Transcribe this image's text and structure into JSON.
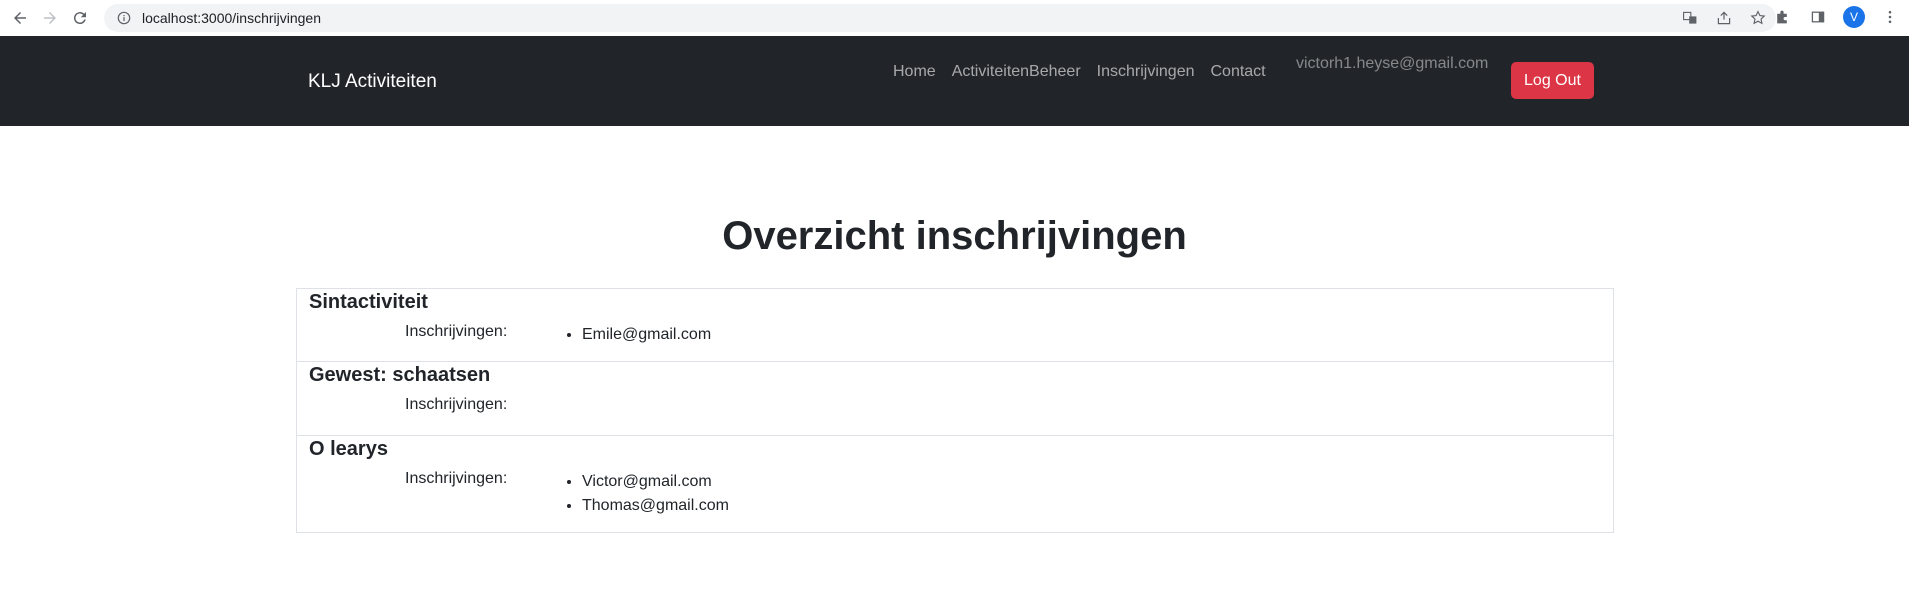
{
  "browser": {
    "url": "localhost:3000/inschrijvingen",
    "avatar_initial": "V"
  },
  "navbar": {
    "brand": "KLJ Activiteiten",
    "links": [
      "Home",
      "ActiviteitenBeheer",
      "Inschrijvingen",
      "Contact"
    ],
    "user_email": "victorh1.heyse@gmail.com",
    "logout_label": "Log Out",
    "background_color": "#212529",
    "logout_color": "#dc3545"
  },
  "main": {
    "title": "Overzicht inschrijvingen",
    "registrations_label": "Inschrijvingen:",
    "activities": [
      {
        "name": "Sintactiviteit",
        "registrations": [
          "Emile@gmail.com"
        ]
      },
      {
        "name": "Gewest: schaatsen",
        "registrations": []
      },
      {
        "name": "O learys",
        "registrations": [
          "Victor@gmail.com",
          "Thomas@gmail.com"
        ]
      }
    ]
  }
}
